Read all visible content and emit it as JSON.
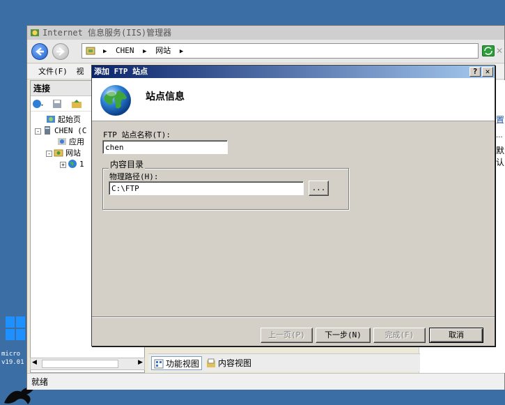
{
  "desktop": {
    "text_line1": "micro",
    "text_line2": "v19.01",
    "windows_accent": "#1e90ff"
  },
  "iis": {
    "title": "Internet 信息服务(IIS)管理器",
    "address": {
      "crumb1": "CHEN",
      "crumb2": "网站",
      "sep": "▶"
    },
    "menu": {
      "file": "文件(F)",
      "view_partial": "视"
    },
    "connections": {
      "header": "连接",
      "tree": {
        "start_page": "起始页",
        "server": "CHEN (C",
        "app_pools": "应用",
        "sites": "网站",
        "site1": "1"
      }
    },
    "right_fragments": {
      "frag1": "置",
      "frag2": "...",
      "frag3": "默认"
    },
    "view_tabs": {
      "features": "功能视图",
      "content": "内容视图"
    },
    "status": "就绪"
  },
  "dialog": {
    "title": "添加 FTP 站点",
    "help": "?",
    "close": "✕",
    "header_title": "站点信息",
    "site_name_label": "FTP 站点名称(T):",
    "site_name_value": "chen",
    "content_dir_legend": "内容目录",
    "physical_path_label": "物理路径(H):",
    "physical_path_value": "C:\\FTP",
    "browse_label": "...",
    "buttons": {
      "prev": "上一页(P)",
      "next": "下一步(N)",
      "finish": "完成(F)",
      "cancel": "取消"
    },
    "title_gradient_start": "#0a246a",
    "title_gradient_end": "#a6caf0"
  }
}
